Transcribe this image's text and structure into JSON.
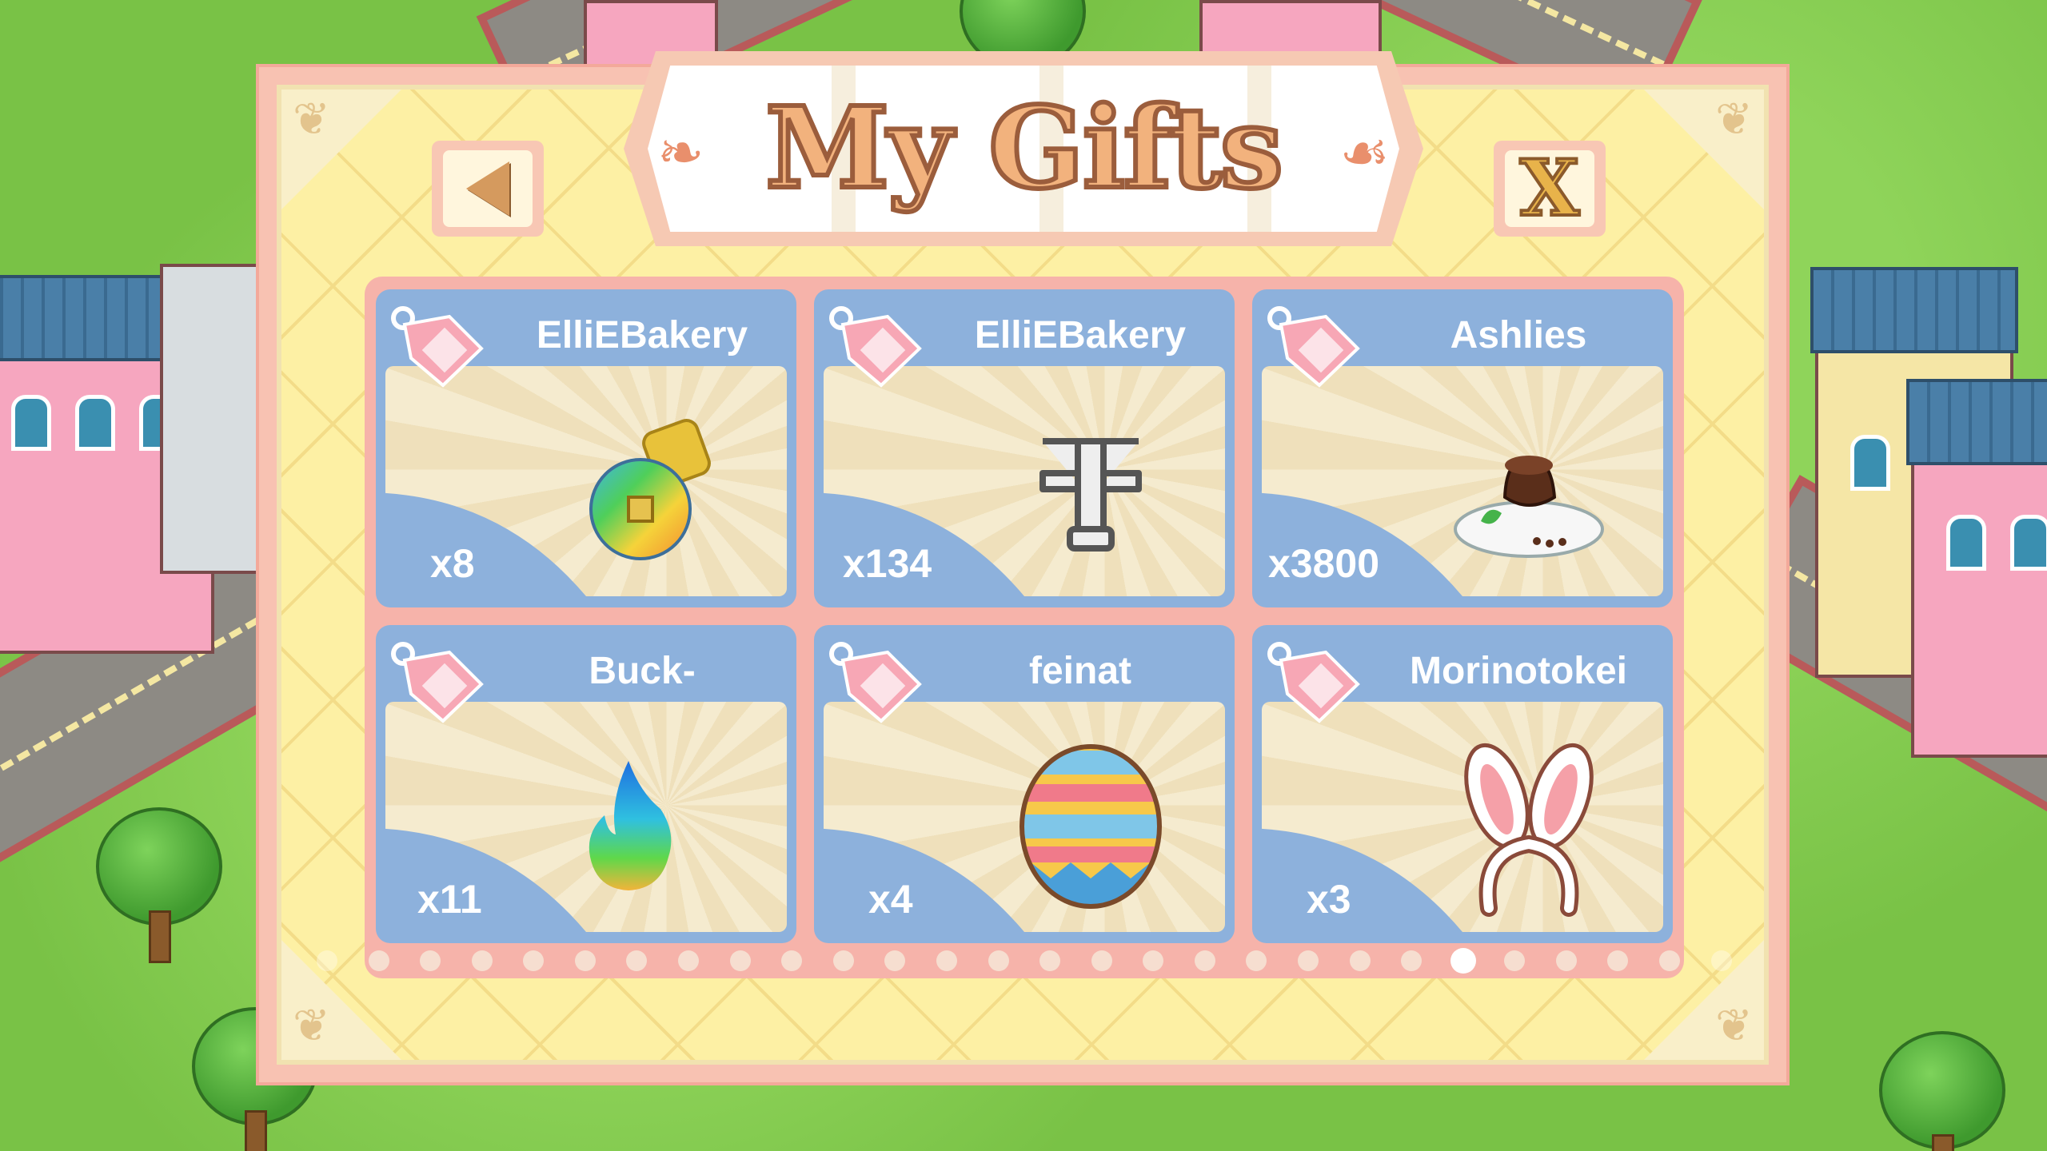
{
  "dialog": {
    "title": "My Gifts",
    "close_label": "X"
  },
  "gifts": [
    {
      "sender": "ElliEBakery",
      "quantity": "x8",
      "item_icon": "rainbow-screw-icon"
    },
    {
      "sender": "ElliEBakery",
      "quantity": "x134",
      "item_icon": "metal-bracket-icon"
    },
    {
      "sender": "Ashlies",
      "quantity": "x3800",
      "item_icon": "chocolate-cake-icon"
    },
    {
      "sender": "Buck-",
      "quantity": "x11",
      "item_icon": "rainbow-flame-icon"
    },
    {
      "sender": "feinat",
      "quantity": "x4",
      "item_icon": "easter-egg-icon"
    },
    {
      "sender": "Morinotokei",
      "quantity": "x3",
      "item_icon": "bunny-ears-icon"
    }
  ],
  "pagination": {
    "total_dots": 28,
    "active_index": 22
  },
  "colors": {
    "panel_bg": "#fdf0a4",
    "card_header": "#8db1dc",
    "title_text": "#f2b27d"
  }
}
